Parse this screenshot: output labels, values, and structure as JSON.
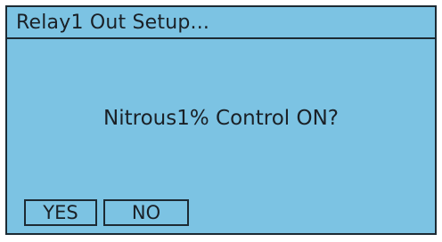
{
  "dialog": {
    "title": "Relay1 Out Setup...",
    "message": "Nitrous1% Control ON?",
    "buttons": {
      "yes_label": "YES",
      "no_label": "NO"
    }
  },
  "colors": {
    "screen_background": "#7cc3e3",
    "border": "#1c2a33",
    "text": "#1a2026"
  }
}
